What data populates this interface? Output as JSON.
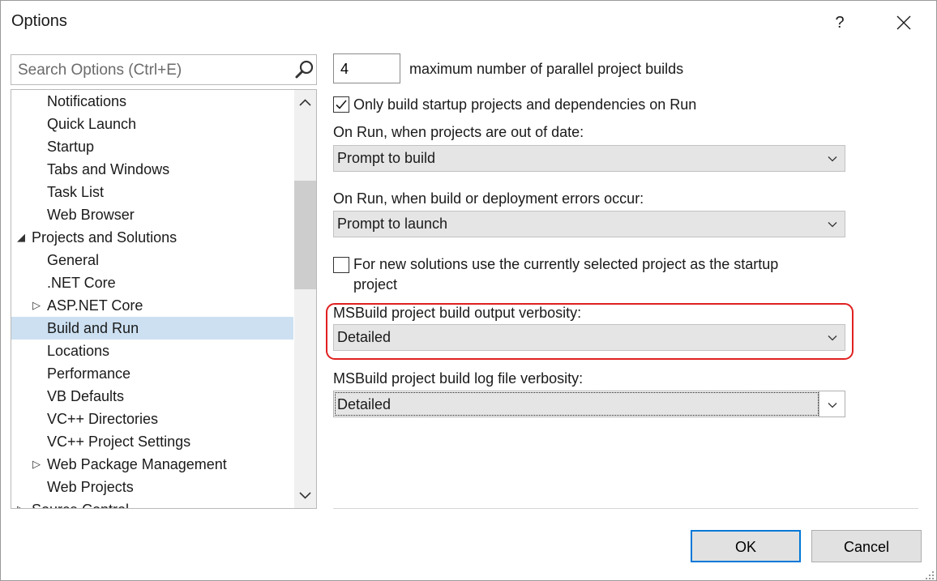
{
  "window": {
    "title": "Options",
    "help_glyph": "?",
    "close_glyph": "✕"
  },
  "search": {
    "placeholder": "Search Options (Ctrl+E)",
    "icon": "search-icon"
  },
  "tree": {
    "items": [
      {
        "label": "Notifications",
        "expander": ""
      },
      {
        "label": "Quick Launch",
        "expander": ""
      },
      {
        "label": "Startup",
        "expander": ""
      },
      {
        "label": "Tabs and Windows",
        "expander": ""
      },
      {
        "label": "Task List",
        "expander": ""
      },
      {
        "label": "Web Browser",
        "expander": ""
      },
      {
        "label": "Projects and Solutions",
        "expander": "◢"
      },
      {
        "label": "General",
        "expander": ""
      },
      {
        "label": ".NET Core",
        "expander": ""
      },
      {
        "label": "ASP.NET Core",
        "expander": "▷"
      },
      {
        "label": "Build and Run",
        "expander": ""
      },
      {
        "label": "Locations",
        "expander": ""
      },
      {
        "label": "Performance",
        "expander": ""
      },
      {
        "label": "VB Defaults",
        "expander": ""
      },
      {
        "label": "VC++ Directories",
        "expander": ""
      },
      {
        "label": "VC++ Project Settings",
        "expander": ""
      },
      {
        "label": "Web Package Management",
        "expander": "▷"
      },
      {
        "label": "Web Projects",
        "expander": ""
      },
      {
        "label": "Source Control",
        "expander": "▷"
      }
    ],
    "selected": "Build and Run"
  },
  "settings": {
    "parallel_builds_value": "4",
    "parallel_builds_label": "maximum number of parallel project builds",
    "only_build_startup_label": "Only build startup projects and dependencies on Run",
    "only_build_startup_checked": true,
    "out_of_date_label": "On Run, when projects are out of date:",
    "out_of_date_value": "Prompt to build",
    "errors_label": "On Run, when build or deployment errors occur:",
    "errors_value": "Prompt to launch",
    "new_solutions_label_line1": "For new solutions use the currently selected project as the startup",
    "new_solutions_label_line2": "project",
    "new_solutions_checked": false,
    "output_verbosity_label": "MSBuild project build output verbosity:",
    "output_verbosity_value": "Detailed",
    "log_verbosity_label": "MSBuild project build log file verbosity:",
    "log_verbosity_value": "Detailed"
  },
  "buttons": {
    "ok": "OK",
    "cancel": "Cancel"
  },
  "colors": {
    "highlight": "#e02020",
    "selection": "#cce0f1",
    "default_button_border": "#0078d7"
  }
}
